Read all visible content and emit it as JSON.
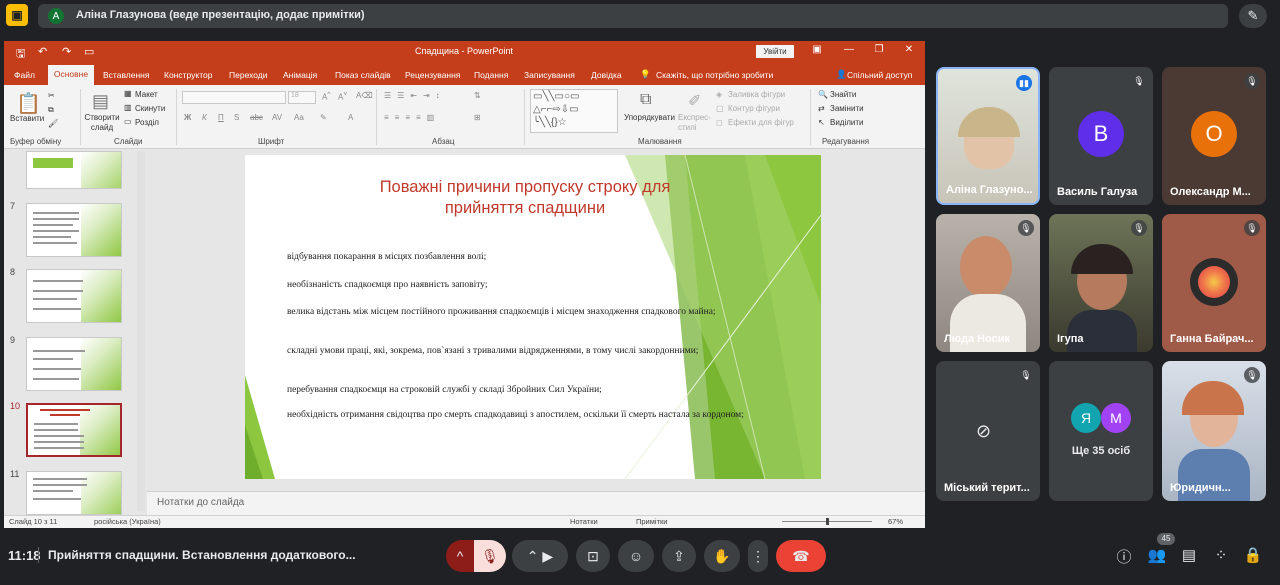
{
  "presenter": {
    "avatar_letter": "А",
    "text": "Аліна Глазунова (веде презентацію, додає примітки)"
  },
  "ppt": {
    "title": "Спадщина  -  PowerPoint",
    "signin": "Увійти",
    "menu": [
      "Файл",
      "Основне",
      "Вставлення",
      "Конструктор",
      "Переходи",
      "Анімація",
      "Показ слайдів",
      "Рецензування",
      "Подання",
      "Записування",
      "Довідка",
      "Скажіть, що потрібно зробити",
      "Спільний доступ"
    ],
    "ribbon": {
      "paste": "Вставити",
      "clipboard": "Буфер обміну",
      "new_slide": "Створити слайд",
      "layout": "Макет",
      "reset": "Скинути",
      "section": "Розділ",
      "slides": "Слайди",
      "font": "Шрифт",
      "paragraph": "Абзац",
      "arrange": "Упорядкувати",
      "quick_styles": "Експрес-стилі",
      "fill": "Заливка фігури",
      "outline": "Контур фігури",
      "effects": "Ефекти для фігур",
      "drawing": "Малювання",
      "find": "Знайти",
      "replace": "Замінити",
      "select": "Виділити",
      "editing": "Редагування"
    },
    "thumb_numbers": [
      "7",
      "8",
      "9",
      "10",
      "11"
    ],
    "slide": {
      "title_l1": "Поважні причини пропуску строку для",
      "title_l2": "прийняття спадщини",
      "b1": "відбування покарання в місцях позбавлення волі;",
      "b2": "необізнаність спадкоємця про наявність заповіту;",
      "b3": "велика відстань між місцем постійного проживання спадкоємців і місцем знаходження спадкового майна;",
      "b4": "складні умови праці, які, зокрема, пов`язані з тривалими відрядженнями, в тому числі закордонними;",
      "b5": "перебування спадкоємця на строковій службі у складі Збройних Сил України;",
      "b6": "необхідність отримання свідоцтва про смерть спадкодавиці з апостилем, оскільки її смерть настала за кордоном;"
    },
    "notes": "Нотатки до слайда",
    "status": {
      "slide": "Слайд 10 з 11",
      "lang": "російська (Україна)",
      "notes": "Нотатки",
      "comments": "Примітки",
      "zoom": "67%"
    }
  },
  "participants": [
    {
      "name": "Аліна Глазуно...",
      "speaking": true
    },
    {
      "name": "Василь Галуза",
      "letter": "В",
      "color": "#5f2ee8"
    },
    {
      "name": "Олександр М...",
      "letter": "О",
      "color": "#e8710a"
    },
    {
      "name": "Люда Носик"
    },
    {
      "name": "Ігупа"
    },
    {
      "name": "Ганна Байрач..."
    },
    {
      "name": "Міський терит..."
    },
    {
      "name": "Ще 35 осіб",
      "letters": [
        "Я",
        "М"
      ]
    },
    {
      "name": "Юридичн..."
    }
  ],
  "bottom": {
    "time": "11:18",
    "meeting": "Прийняття спадщини. Встановлення додаткового...",
    "people_count": "45"
  }
}
